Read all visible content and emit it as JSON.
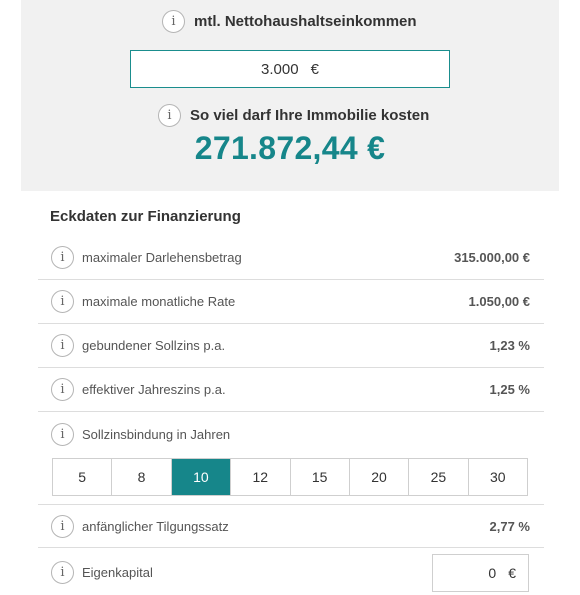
{
  "income": {
    "label": "mtl. Nettohaushaltseinkommen",
    "value": "3.000",
    "currency": "€"
  },
  "property": {
    "label": "So viel darf Ihre Immobilie kosten",
    "price": "271.872,44 €"
  },
  "financing": {
    "title": "Eckdaten zur Finanzierung",
    "rows": [
      {
        "label": "maximaler Darlehensbetrag",
        "value": "315.000,00 €"
      },
      {
        "label": "maximale monatliche Rate",
        "value": "1.050,00 €"
      },
      {
        "label": "gebundener Sollzins p.a.",
        "value": "1,23 %"
      },
      {
        "label": "effektiver Jahreszins p.a.",
        "value": "1,25 %"
      }
    ],
    "term": {
      "label": "Sollzinsbindung in Jahren",
      "options": [
        "5",
        "8",
        "10",
        "12",
        "15",
        "20",
        "25",
        "30"
      ],
      "selected": "10"
    },
    "repayment": {
      "label": "anfänglicher Tilgungssatz",
      "value": "2,77 %"
    },
    "equity": {
      "label": "Eigenkapital",
      "value": "0",
      "currency": "€"
    }
  },
  "colors": {
    "accent": "#16868a",
    "panel_bg": "#f1f1f1",
    "divider": "#dddddd"
  },
  "icons": {
    "info": "i"
  }
}
